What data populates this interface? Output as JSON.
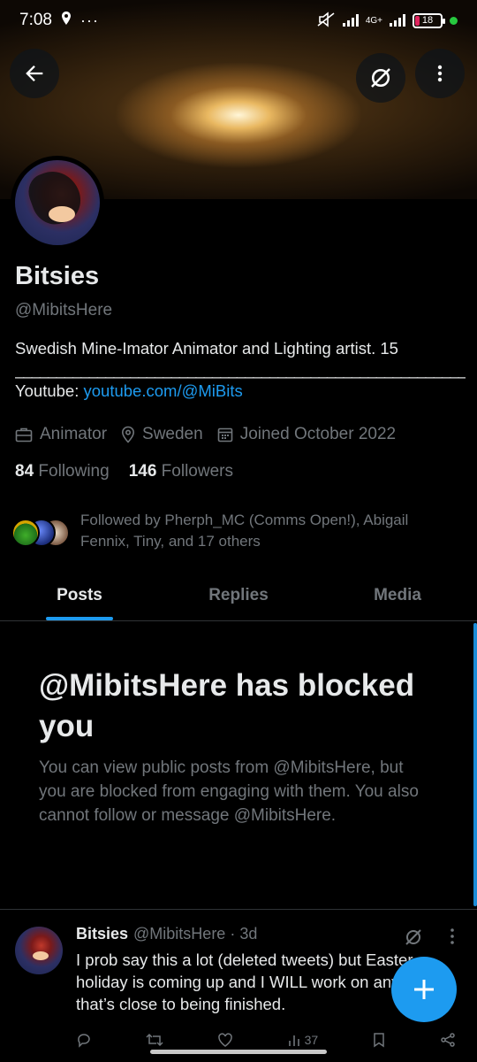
{
  "status_bar": {
    "time": "7:08",
    "network": "4G+",
    "battery": "18"
  },
  "profile": {
    "name": "Bitsies",
    "handle": "@MibitsHere",
    "bio_line1": "Swedish Mine-Imator Animator and Lighting artist. 15",
    "bio_divider": "________________________________________________________",
    "bio_youtube_label": "Youtube: ",
    "bio_youtube_link": "youtube.com/@MiBits",
    "category": "Animator",
    "location": "Sweden",
    "joined": "Joined October 2022",
    "following_count": "84",
    "following_label": "Following",
    "followers_count": "146",
    "followers_label": "Followers",
    "followed_by": "Followed by Pherph_MC (Comms Open!), Abigail Fennix, Tiny, and 17 others"
  },
  "tabs": [
    {
      "label": "Posts",
      "active": true
    },
    {
      "label": "Replies",
      "active": false
    },
    {
      "label": "Media",
      "active": false
    }
  ],
  "blocked": {
    "title": "@MibitsHere has blocked you",
    "message": "You can view public posts from @MibitsHere, but you are blocked from engaging with them. You also cannot follow or message @MibitsHere."
  },
  "tweet": {
    "name": "Bitsies",
    "handle_time": "@MibitsHere · 3d",
    "text": "I prob say this a lot (deleted tweets) but Easter holiday is coming up and I WILL work on anything that’s close to being finished.",
    "views": "37"
  },
  "colors": {
    "accent": "#1d9bf0",
    "background": "#000000",
    "secondary_text": "#71767b"
  }
}
